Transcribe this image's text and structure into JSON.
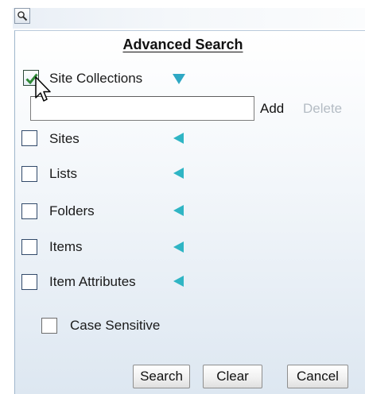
{
  "dialog": {
    "title": "Advanced Search",
    "search_toggle_icon": "search-icon"
  },
  "filters": [
    {
      "key": "site-collections",
      "label": "Site Collections",
      "checked": true,
      "arrow": "down"
    },
    {
      "key": "sites",
      "label": "Sites",
      "checked": false,
      "arrow": "left"
    },
    {
      "key": "lists",
      "label": "Lists",
      "checked": false,
      "arrow": "left"
    },
    {
      "key": "folders",
      "label": "Folders",
      "checked": false,
      "arrow": "left"
    },
    {
      "key": "items",
      "label": "Items",
      "checked": false,
      "arrow": "left"
    },
    {
      "key": "item-attributes",
      "label": "Item Attributes",
      "checked": false,
      "arrow": "left"
    }
  ],
  "site_collections_editor": {
    "value": "",
    "add_label": "Add",
    "delete_label": "Delete"
  },
  "case_sensitive": {
    "label": "Case Sensitive",
    "checked": false
  },
  "buttons": {
    "search": "Search",
    "clear": "Clear",
    "cancel": "Cancel"
  },
  "colors": {
    "arrow": "#2fb5c4",
    "panel_bottom": "#dde7f1",
    "delete_disabled": "#b4bcc4"
  }
}
